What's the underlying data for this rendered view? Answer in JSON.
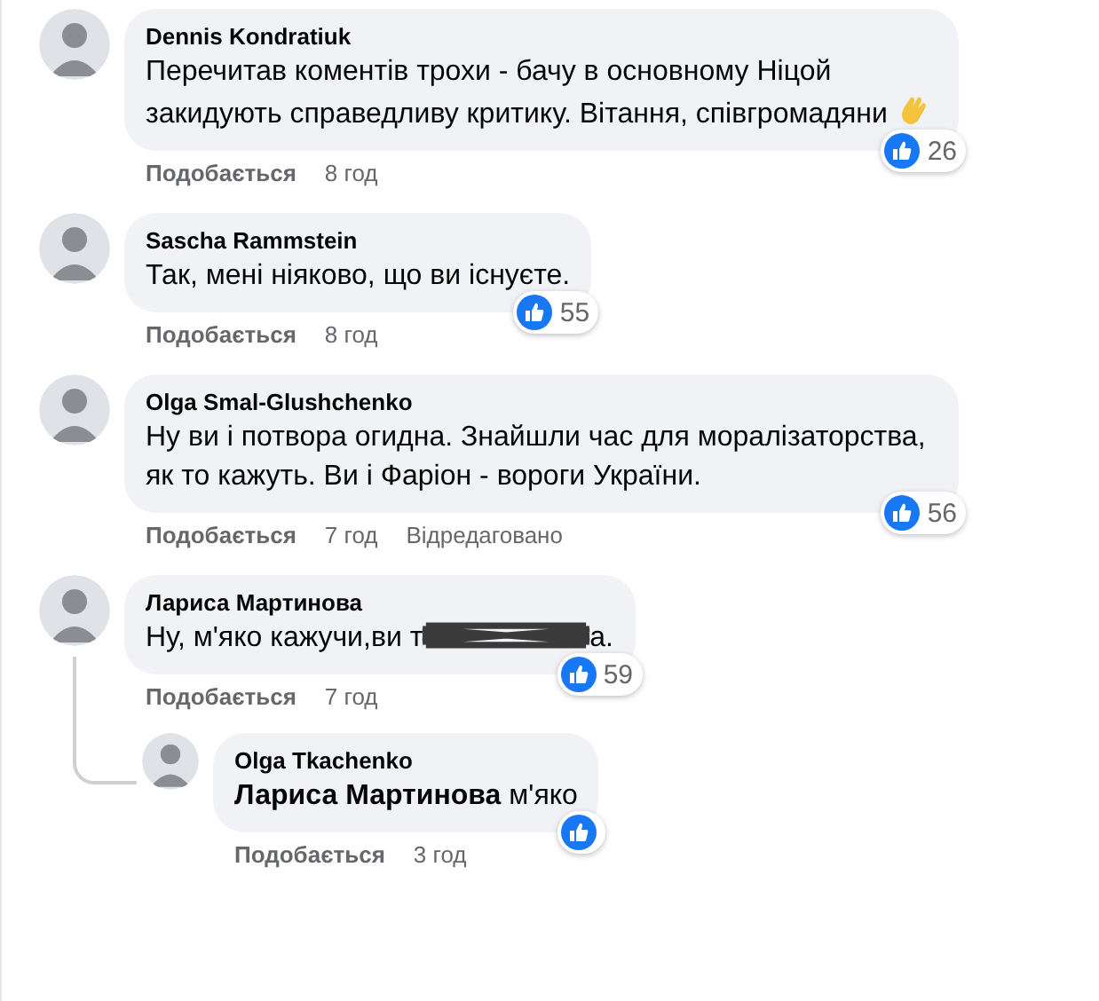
{
  "comments": [
    {
      "author": "Dennis Kondratiuk",
      "parts": [
        {
          "kind": "text",
          "text": "Перечитав коментів трохи - бачу в основному Ніцой закидують справедливу критику. Вітання, співгромадяни"
        },
        {
          "kind": "wave"
        }
      ],
      "reactions": "26",
      "like": "Подобається",
      "time": "8 год"
    },
    {
      "author": "Sascha Rammstein",
      "text": "Так, мені ніяково, що ви існуєте.",
      "reactions": "55",
      "like": "Подобається",
      "time": "8 год"
    },
    {
      "author": "Olga Smal-Glushchenko",
      "text": "Ну ви і потвора огидна. Знайшли час для моралізаторства, як то кажуть. Ви і Фаріон - вороги України.",
      "reactions": "56",
      "like": "Подобається",
      "time": "7 год",
      "edited": "Відредаговано"
    },
    {
      "author": "Лариса Мартинова",
      "parts": [
        {
          "kind": "text",
          "text": "Ну, м'яко кажучи,ви т"
        },
        {
          "kind": "scribble"
        },
        {
          "kind": "text",
          "text": "а."
        }
      ],
      "reactions": "59",
      "like": "Подобається",
      "time": "7 год",
      "replies": [
        {
          "author": "Olga Tkachenko",
          "text": "**Лариса Мартинова** м'яко",
          "like": "Подобається",
          "time": "3 год"
        }
      ]
    }
  ]
}
